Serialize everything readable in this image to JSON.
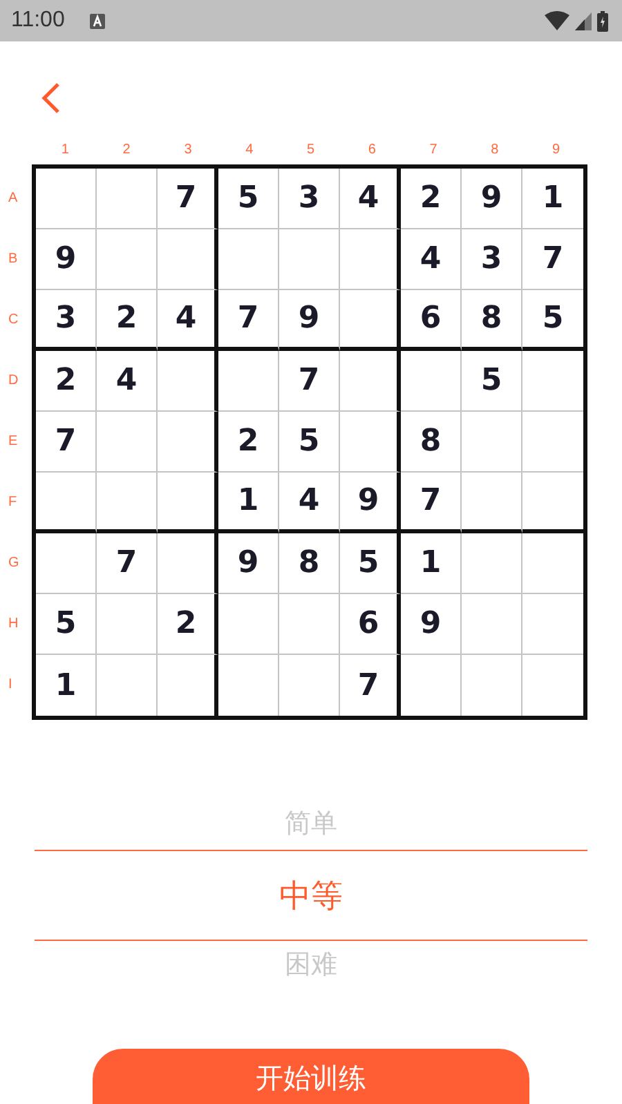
{
  "status_bar": {
    "time": "11:00"
  },
  "column_labels": [
    "1",
    "2",
    "3",
    "4",
    "5",
    "6",
    "7",
    "8",
    "9"
  ],
  "rows": [
    {
      "label": "A",
      "cells": [
        null,
        null,
        "7",
        "5",
        "3",
        "4",
        "2",
        "9",
        "1"
      ]
    },
    {
      "label": "B",
      "cells": [
        "9",
        null,
        null,
        null,
        null,
        null,
        "4",
        "3",
        "7"
      ]
    },
    {
      "label": "C",
      "cells": [
        "3",
        "2",
        "4",
        "7",
        "9",
        null,
        "6",
        "8",
        "5"
      ]
    },
    {
      "label": "D",
      "cells": [
        "2",
        "4",
        null,
        null,
        "7",
        null,
        null,
        "5",
        null
      ]
    },
    {
      "label": "E",
      "cells": [
        "7",
        null,
        null,
        "2",
        "5",
        null,
        "8",
        null,
        null
      ]
    },
    {
      "label": "F",
      "cells": [
        null,
        null,
        null,
        "1",
        "4",
        "9",
        "7",
        null,
        null
      ]
    },
    {
      "label": "G",
      "cells": [
        null,
        "7",
        null,
        "9",
        "8",
        "5",
        "1",
        null,
        null
      ]
    },
    {
      "label": "H",
      "cells": [
        "5",
        null,
        "2",
        null,
        null,
        "6",
        "9",
        null,
        null
      ]
    },
    {
      "label": "I",
      "cells": [
        "1",
        null,
        null,
        null,
        null,
        "7",
        null,
        null,
        null
      ]
    }
  ],
  "difficulty_picker": [
    {
      "label": "简单",
      "selected": false
    },
    {
      "label": "中等",
      "selected": true
    },
    {
      "label": "困难",
      "selected": false
    }
  ],
  "start_button": "开始训练"
}
